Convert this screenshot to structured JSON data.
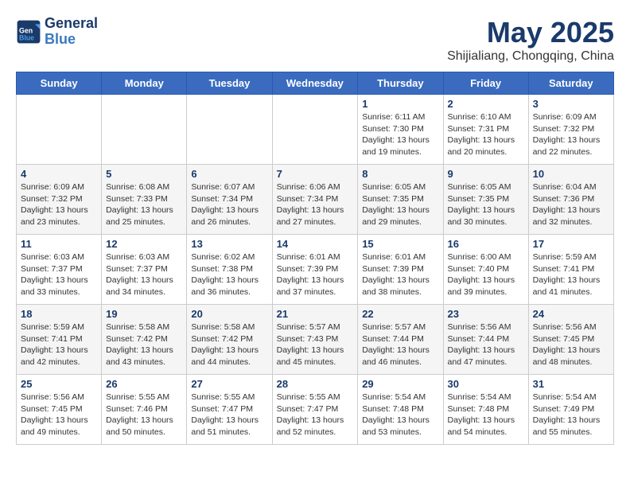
{
  "header": {
    "logo_line1": "General",
    "logo_line2": "Blue",
    "month_title": "May 2025",
    "location": "Shijialiang, Chongqing, China"
  },
  "weekdays": [
    "Sunday",
    "Monday",
    "Tuesday",
    "Wednesday",
    "Thursday",
    "Friday",
    "Saturday"
  ],
  "weeks": [
    [
      {
        "day": "",
        "info": ""
      },
      {
        "day": "",
        "info": ""
      },
      {
        "day": "",
        "info": ""
      },
      {
        "day": "",
        "info": ""
      },
      {
        "day": "1",
        "info": "Sunrise: 6:11 AM\nSunset: 7:30 PM\nDaylight: 13 hours\nand 19 minutes."
      },
      {
        "day": "2",
        "info": "Sunrise: 6:10 AM\nSunset: 7:31 PM\nDaylight: 13 hours\nand 20 minutes."
      },
      {
        "day": "3",
        "info": "Sunrise: 6:09 AM\nSunset: 7:32 PM\nDaylight: 13 hours\nand 22 minutes."
      }
    ],
    [
      {
        "day": "4",
        "info": "Sunrise: 6:09 AM\nSunset: 7:32 PM\nDaylight: 13 hours\nand 23 minutes."
      },
      {
        "day": "5",
        "info": "Sunrise: 6:08 AM\nSunset: 7:33 PM\nDaylight: 13 hours\nand 25 minutes."
      },
      {
        "day": "6",
        "info": "Sunrise: 6:07 AM\nSunset: 7:34 PM\nDaylight: 13 hours\nand 26 minutes."
      },
      {
        "day": "7",
        "info": "Sunrise: 6:06 AM\nSunset: 7:34 PM\nDaylight: 13 hours\nand 27 minutes."
      },
      {
        "day": "8",
        "info": "Sunrise: 6:05 AM\nSunset: 7:35 PM\nDaylight: 13 hours\nand 29 minutes."
      },
      {
        "day": "9",
        "info": "Sunrise: 6:05 AM\nSunset: 7:35 PM\nDaylight: 13 hours\nand 30 minutes."
      },
      {
        "day": "10",
        "info": "Sunrise: 6:04 AM\nSunset: 7:36 PM\nDaylight: 13 hours\nand 32 minutes."
      }
    ],
    [
      {
        "day": "11",
        "info": "Sunrise: 6:03 AM\nSunset: 7:37 PM\nDaylight: 13 hours\nand 33 minutes."
      },
      {
        "day": "12",
        "info": "Sunrise: 6:03 AM\nSunset: 7:37 PM\nDaylight: 13 hours\nand 34 minutes."
      },
      {
        "day": "13",
        "info": "Sunrise: 6:02 AM\nSunset: 7:38 PM\nDaylight: 13 hours\nand 36 minutes."
      },
      {
        "day": "14",
        "info": "Sunrise: 6:01 AM\nSunset: 7:39 PM\nDaylight: 13 hours\nand 37 minutes."
      },
      {
        "day": "15",
        "info": "Sunrise: 6:01 AM\nSunset: 7:39 PM\nDaylight: 13 hours\nand 38 minutes."
      },
      {
        "day": "16",
        "info": "Sunrise: 6:00 AM\nSunset: 7:40 PM\nDaylight: 13 hours\nand 39 minutes."
      },
      {
        "day": "17",
        "info": "Sunrise: 5:59 AM\nSunset: 7:41 PM\nDaylight: 13 hours\nand 41 minutes."
      }
    ],
    [
      {
        "day": "18",
        "info": "Sunrise: 5:59 AM\nSunset: 7:41 PM\nDaylight: 13 hours\nand 42 minutes."
      },
      {
        "day": "19",
        "info": "Sunrise: 5:58 AM\nSunset: 7:42 PM\nDaylight: 13 hours\nand 43 minutes."
      },
      {
        "day": "20",
        "info": "Sunrise: 5:58 AM\nSunset: 7:42 PM\nDaylight: 13 hours\nand 44 minutes."
      },
      {
        "day": "21",
        "info": "Sunrise: 5:57 AM\nSunset: 7:43 PM\nDaylight: 13 hours\nand 45 minutes."
      },
      {
        "day": "22",
        "info": "Sunrise: 5:57 AM\nSunset: 7:44 PM\nDaylight: 13 hours\nand 46 minutes."
      },
      {
        "day": "23",
        "info": "Sunrise: 5:56 AM\nSunset: 7:44 PM\nDaylight: 13 hours\nand 47 minutes."
      },
      {
        "day": "24",
        "info": "Sunrise: 5:56 AM\nSunset: 7:45 PM\nDaylight: 13 hours\nand 48 minutes."
      }
    ],
    [
      {
        "day": "25",
        "info": "Sunrise: 5:56 AM\nSunset: 7:45 PM\nDaylight: 13 hours\nand 49 minutes."
      },
      {
        "day": "26",
        "info": "Sunrise: 5:55 AM\nSunset: 7:46 PM\nDaylight: 13 hours\nand 50 minutes."
      },
      {
        "day": "27",
        "info": "Sunrise: 5:55 AM\nSunset: 7:47 PM\nDaylight: 13 hours\nand 51 minutes."
      },
      {
        "day": "28",
        "info": "Sunrise: 5:55 AM\nSunset: 7:47 PM\nDaylight: 13 hours\nand 52 minutes."
      },
      {
        "day": "29",
        "info": "Sunrise: 5:54 AM\nSunset: 7:48 PM\nDaylight: 13 hours\nand 53 minutes."
      },
      {
        "day": "30",
        "info": "Sunrise: 5:54 AM\nSunset: 7:48 PM\nDaylight: 13 hours\nand 54 minutes."
      },
      {
        "day": "31",
        "info": "Sunrise: 5:54 AM\nSunset: 7:49 PM\nDaylight: 13 hours\nand 55 minutes."
      }
    ]
  ]
}
